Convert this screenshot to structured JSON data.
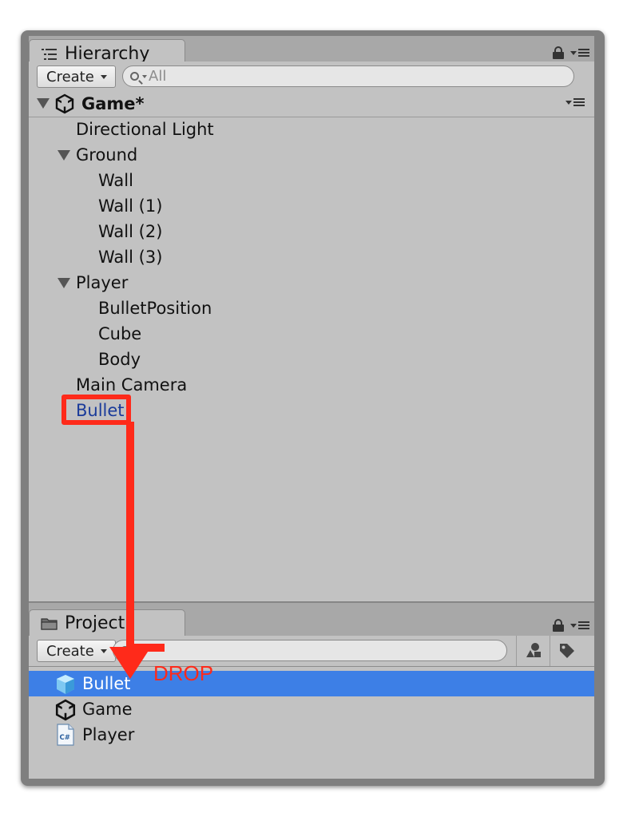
{
  "hierarchy": {
    "tab_label": "Hierarchy",
    "create_label": "Create",
    "search_placeholder": "All",
    "scene_name": "Game*",
    "items": [
      {
        "label": "Directional Light"
      },
      {
        "label": "Ground",
        "expanded": true
      },
      {
        "label": "Wall"
      },
      {
        "label": "Wall (1)"
      },
      {
        "label": "Wall (2)"
      },
      {
        "label": "Wall (3)"
      },
      {
        "label": "Player",
        "expanded": true
      },
      {
        "label": "BulletPosition"
      },
      {
        "label": "Cube"
      },
      {
        "label": "Body"
      },
      {
        "label": "Main Camera"
      },
      {
        "label": "Bullet"
      }
    ]
  },
  "project": {
    "tab_label": "Project",
    "create_label": "Create",
    "items": [
      {
        "label": "Bullet",
        "icon": "prefab-cube-icon",
        "selected": true
      },
      {
        "label": "Game",
        "icon": "unity-scene-icon"
      },
      {
        "label": "Player",
        "icon": "csharp-script-icon"
      }
    ]
  },
  "annotation": {
    "drop_label": "DROP",
    "color": "#ff2a1a"
  },
  "colors": {
    "selection": "#3d7fe6",
    "panel": "#c2c2c2",
    "link_text": "#1a3b9a"
  }
}
